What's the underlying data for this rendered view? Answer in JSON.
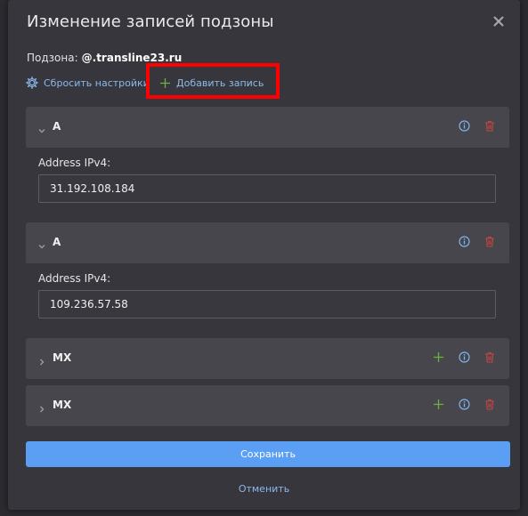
{
  "dialog": {
    "title": "Изменение записей подзоны",
    "subzone_label": "Подзона:",
    "subzone_value": "@.transline23.ru"
  },
  "actions": {
    "reset_label": "Сбросить настройки",
    "add_label": "Добавить запись"
  },
  "records": [
    {
      "type": "A",
      "expanded": true,
      "field_label": "Address IPv4:",
      "field_value": "31.192.108.184"
    },
    {
      "type": "A",
      "expanded": true,
      "field_label": "Address IPv4:",
      "field_value": "109.236.57.58"
    },
    {
      "type": "MX",
      "expanded": false
    },
    {
      "type": "MX",
      "expanded": false
    }
  ],
  "footer": {
    "save_label": "Сохранить",
    "cancel_label": "Отменить"
  },
  "colors": {
    "accent": "#5b9ff5",
    "link": "#8cb8ee",
    "delete": "#c8453f",
    "add": "#6cb33e",
    "highlight": "#ff0000"
  },
  "icons": [
    "close-icon",
    "gear-icon",
    "plus-icon",
    "chevron-down-icon",
    "chevron-right-icon",
    "info-icon",
    "trash-icon"
  ]
}
